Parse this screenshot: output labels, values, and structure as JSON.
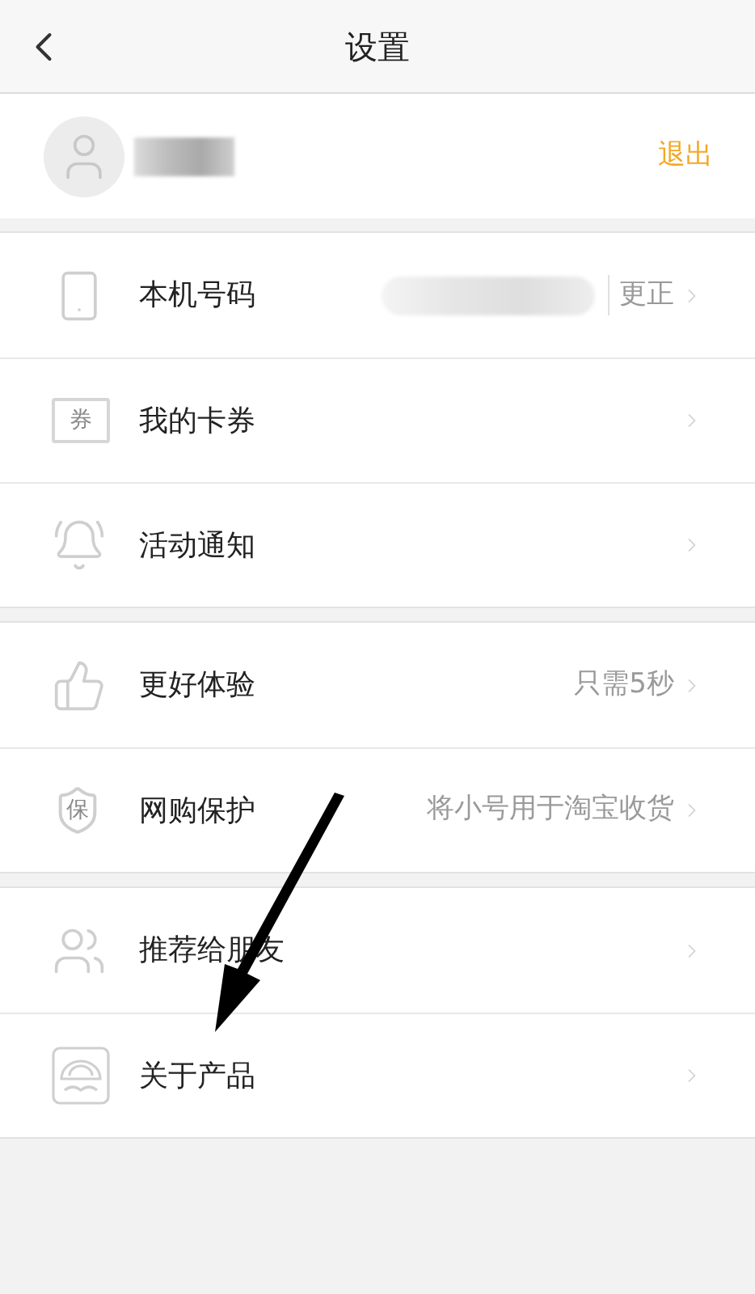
{
  "header": {
    "title": "设置"
  },
  "profile": {
    "name_redacted": true,
    "logout": "退出"
  },
  "groups": [
    {
      "items": [
        {
          "label": "本机号码",
          "value_redacted": true,
          "action": "更正"
        },
        {
          "label": "我的卡券",
          "icon_label": "券"
        },
        {
          "label": "活动通知"
        }
      ]
    },
    {
      "items": [
        {
          "label": "更好体验",
          "detail": "只需5秒"
        },
        {
          "label": "网购保护",
          "icon_label": "保",
          "detail": "将小号用于淘宝收货"
        }
      ]
    },
    {
      "items": [
        {
          "label": "推荐给朋友"
        },
        {
          "label": "关于产品"
        }
      ]
    }
  ],
  "annotation": {
    "kind": "arrow"
  }
}
